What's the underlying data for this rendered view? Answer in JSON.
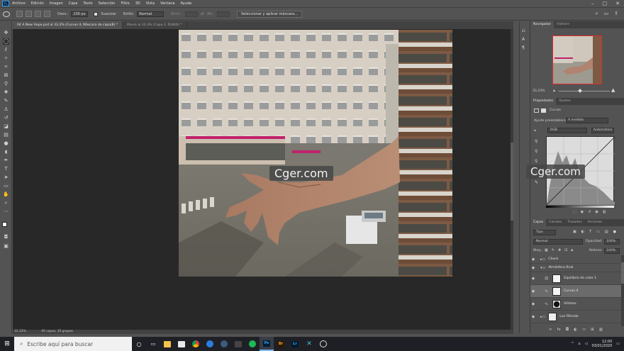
{
  "menubar": {
    "app_logo": "Ps",
    "items": [
      "Archivo",
      "Edición",
      "Imagen",
      "Capa",
      "Texto",
      "Selección",
      "Filtro",
      "3D",
      "Vista",
      "Ventana",
      "Ayuda"
    ],
    "window_controls": [
      "minimize-icon",
      "maximize-icon",
      "close-icon"
    ]
  },
  "options": {
    "feather_label": "Desv.:",
    "feather_value": "200 px",
    "smooth_label": "Suavizar",
    "style_label": "Estilo:",
    "style_value": "Normal",
    "width_label": "Anch.:",
    "height_label": "Alt.:",
    "select_mask_button": "Seleccionar y aplicar máscara..."
  },
  "tabs": [
    {
      "label": "04 A New Hope.psd al 33,3% (Curvas 4, Máscara de capa/8) *",
      "active": true
    },
    {
      "label": "Movie al 33,3% (Capa 2, RGB/8) *",
      "active": false
    }
  ],
  "status": {
    "zoom": "33,33%",
    "info": "45 capas, 35 grupos"
  },
  "navigator": {
    "tabs": [
      "Navegador",
      "Histoire"
    ],
    "zoom": "33,33%"
  },
  "properties": {
    "tabs": [
      "Propiedades",
      "Ajustes"
    ],
    "title": "Curvas",
    "preset_label": "Ajuste preestablecido:",
    "preset_value": "A medida",
    "channel_value": "RGB",
    "auto_button": "Automático"
  },
  "layers": {
    "tabs": [
      "Capas",
      "Canales",
      "Trazados",
      "Acciones"
    ],
    "kind_filter": "Tipo",
    "blend_mode": "Normal",
    "opacity_label": "Opacidad:",
    "opacity_value": "100%",
    "lock_label": "Bloq.:",
    "fill_label": "Relleno:",
    "fill_value": "100%",
    "rows": [
      {
        "name": "Check"
      },
      {
        "name": "Atmósfera final"
      },
      {
        "name": "Equilibrio de color 1"
      },
      {
        "name": "Curvas 4"
      },
      {
        "name": "Viñeteo"
      },
      {
        "name": "Luz Filtrada"
      }
    ]
  },
  "watermarks": [
    "Cger.com",
    "Cger.com"
  ],
  "taskbar": {
    "search_placeholder": "Escribe aquí para buscar",
    "time": "12:00",
    "date": "03/01/2020"
  },
  "colors": {
    "ui_panel": "#535353",
    "ui_dark": "#282828",
    "accent_blue": "#31a8ff",
    "selection_red": "#e02b2b"
  }
}
